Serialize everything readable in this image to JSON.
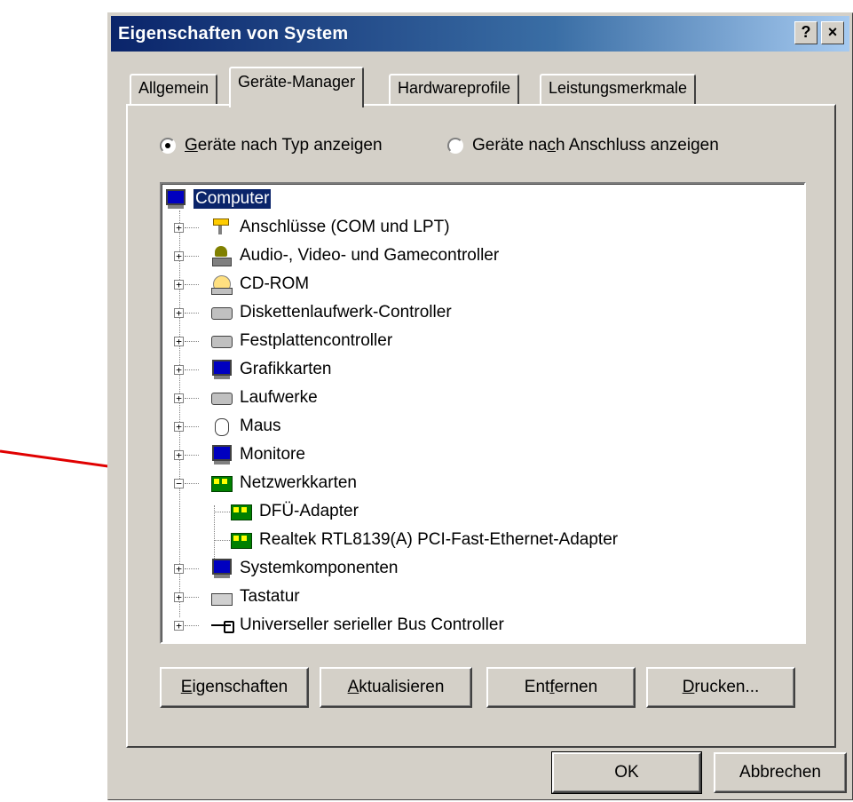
{
  "window": {
    "title": "Eigenschaften von System",
    "help_label": "?",
    "close_label": "×"
  },
  "tabs": [
    {
      "label": "Allgemein",
      "active": false
    },
    {
      "label": "Geräte-Manager",
      "active": true
    },
    {
      "label": "Hardwareprofile",
      "active": false
    },
    {
      "label": "Leistungsmerkmale",
      "active": false
    }
  ],
  "view_options": {
    "by_type": {
      "pre": "",
      "u": "G",
      "post": "eräte nach Typ anzeigen",
      "selected": true
    },
    "by_connection": {
      "pre": "Geräte na",
      "u": "c",
      "post": "h Anschluss anzeigen",
      "selected": false
    }
  },
  "tree": {
    "root": "Computer",
    "items": [
      {
        "label": "Anschlüsse (COM und LPT)",
        "icon": "port-icon"
      },
      {
        "label": "Audio-, Video- und Gamecontroller",
        "icon": "audio-icon"
      },
      {
        "label": "CD-ROM",
        "icon": "cdrom-icon"
      },
      {
        "label": "Diskettenlaufwerk-Controller",
        "icon": "controller-icon"
      },
      {
        "label": "Festplattencontroller",
        "icon": "controller-icon"
      },
      {
        "label": "Grafikkarten",
        "icon": "monitor-icon"
      },
      {
        "label": "Laufwerke",
        "icon": "drive-icon"
      },
      {
        "label": "Maus",
        "icon": "mouse-icon"
      },
      {
        "label": "Monitore",
        "icon": "monitor-icon"
      },
      {
        "label": "Netzwerkkarten",
        "icon": "network-card-icon",
        "expanded": true,
        "children": [
          {
            "label": "DFÜ-Adapter",
            "icon": "network-card-icon"
          },
          {
            "label": "Realtek RTL8139(A) PCI-Fast-Ethernet-Adapter",
            "icon": "network-card-icon"
          }
        ]
      },
      {
        "label": "Systemkomponenten",
        "icon": "monitor-icon"
      },
      {
        "label": "Tastatur",
        "icon": "keyboard-icon"
      },
      {
        "label": "Universeller serieller Bus Controller",
        "icon": "usb-icon"
      }
    ]
  },
  "panel_buttons": {
    "properties": {
      "pre": "",
      "u": "E",
      "post": "igenschaften"
    },
    "refresh": {
      "pre": "",
      "u": "A",
      "post": "ktualisieren"
    },
    "remove": {
      "pre": "Ent",
      "u": "f",
      "post": "ernen"
    },
    "print": {
      "pre": "",
      "u": "D",
      "post": "rucken..."
    }
  },
  "dialog_buttons": {
    "ok": "OK",
    "cancel": "Abbrechen"
  },
  "annotation": {
    "arrow_color": "#e00000"
  }
}
